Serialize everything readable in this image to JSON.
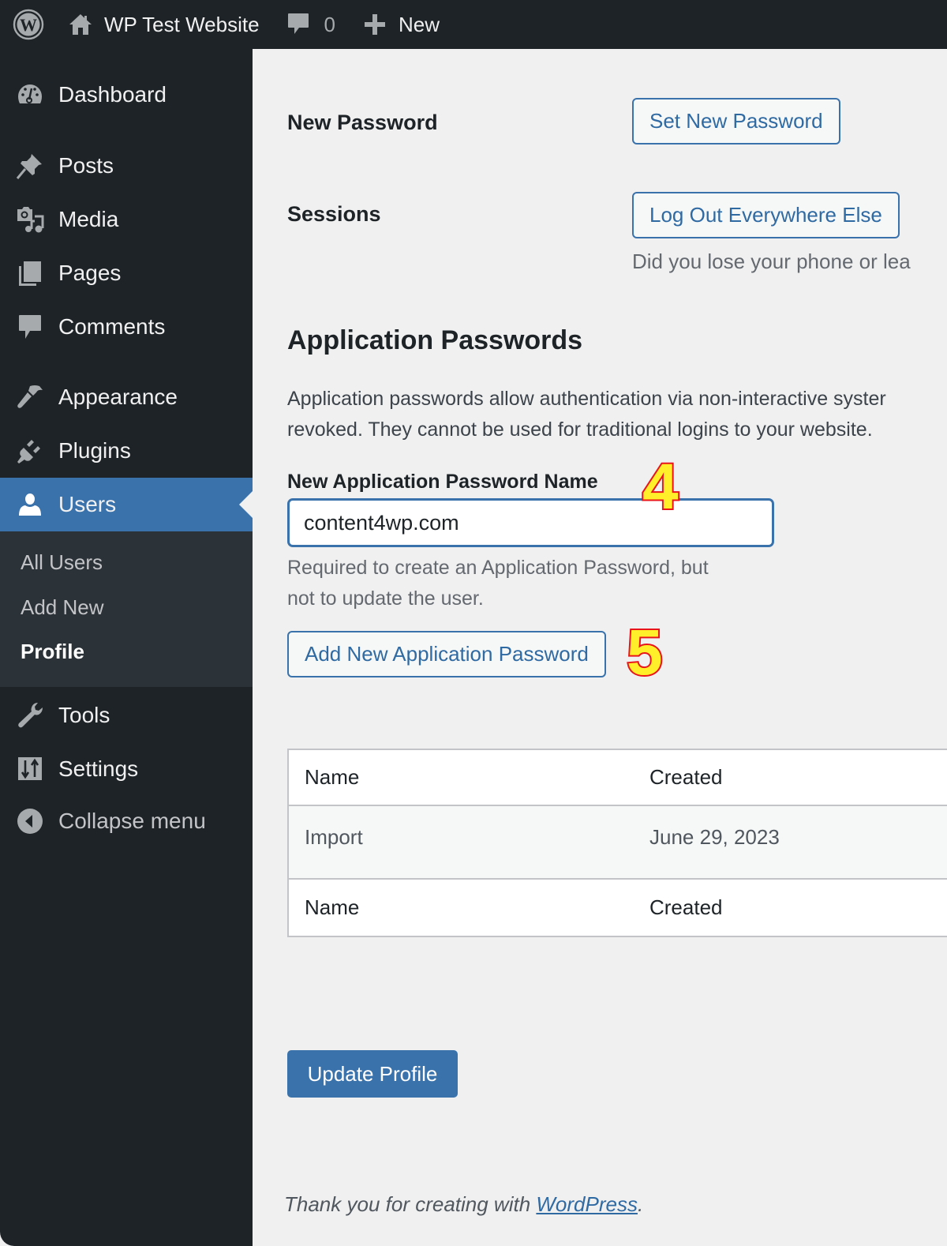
{
  "adminbar": {
    "site_name": "WP Test Website",
    "comments_count": "0",
    "new_label": "New"
  },
  "sidebar": {
    "items": [
      {
        "label": "Dashboard",
        "icon": "dashboard-icon"
      },
      {
        "label": "Posts",
        "icon": "pin-icon"
      },
      {
        "label": "Media",
        "icon": "media-icon"
      },
      {
        "label": "Pages",
        "icon": "pages-icon"
      },
      {
        "label": "Comments",
        "icon": "comment-icon"
      },
      {
        "label": "Appearance",
        "icon": "paintbrush-icon"
      },
      {
        "label": "Plugins",
        "icon": "plugin-icon"
      },
      {
        "label": "Users",
        "icon": "user-icon",
        "active": true
      },
      {
        "label": "Tools",
        "icon": "wrench-icon"
      },
      {
        "label": "Settings",
        "icon": "sliders-icon"
      },
      {
        "label": "Collapse menu",
        "icon": "collapse-arrow-icon"
      }
    ],
    "submenu": [
      {
        "label": "All Users"
      },
      {
        "label": "Add New"
      },
      {
        "label": "Profile",
        "current": true
      }
    ]
  },
  "main": {
    "new_password": {
      "label": "New Password",
      "button": "Set New Password"
    },
    "sessions": {
      "label": "Sessions",
      "button": "Log Out Everywhere Else",
      "description": "Did you lose your phone or lea"
    },
    "app_passwords": {
      "heading": "Application Passwords",
      "description_line1": "Application passwords allow authentication via non-interactive syster",
      "description_line2": "revoked. They cannot be used for traditional logins to your website.",
      "field_label": "New Application Password Name",
      "field_value": "content4wp.com",
      "hint_line1": "Required to create an Application Password, but",
      "hint_line2": "not to update the user.",
      "add_button": "Add New Application Password",
      "table": {
        "columns": [
          "Name",
          "Created"
        ],
        "rows": [
          {
            "name": "Import",
            "created": "June 29, 2023"
          }
        ],
        "footer_columns": [
          "Name",
          "Created"
        ]
      }
    },
    "update_button": "Update Profile",
    "footer_text": "Thank you for creating with ",
    "footer_link": "WordPress",
    "footer_end": "."
  },
  "annotations": {
    "step4": "4",
    "step5": "5",
    "fill_color": "#ffef2a",
    "stroke_color": "#e8141a"
  },
  "colors": {
    "accent": "#3a72ab",
    "sidebar_bg": "#1d2327",
    "submenu_bg": "#2c3338",
    "page_bg": "#f0f0f1"
  }
}
